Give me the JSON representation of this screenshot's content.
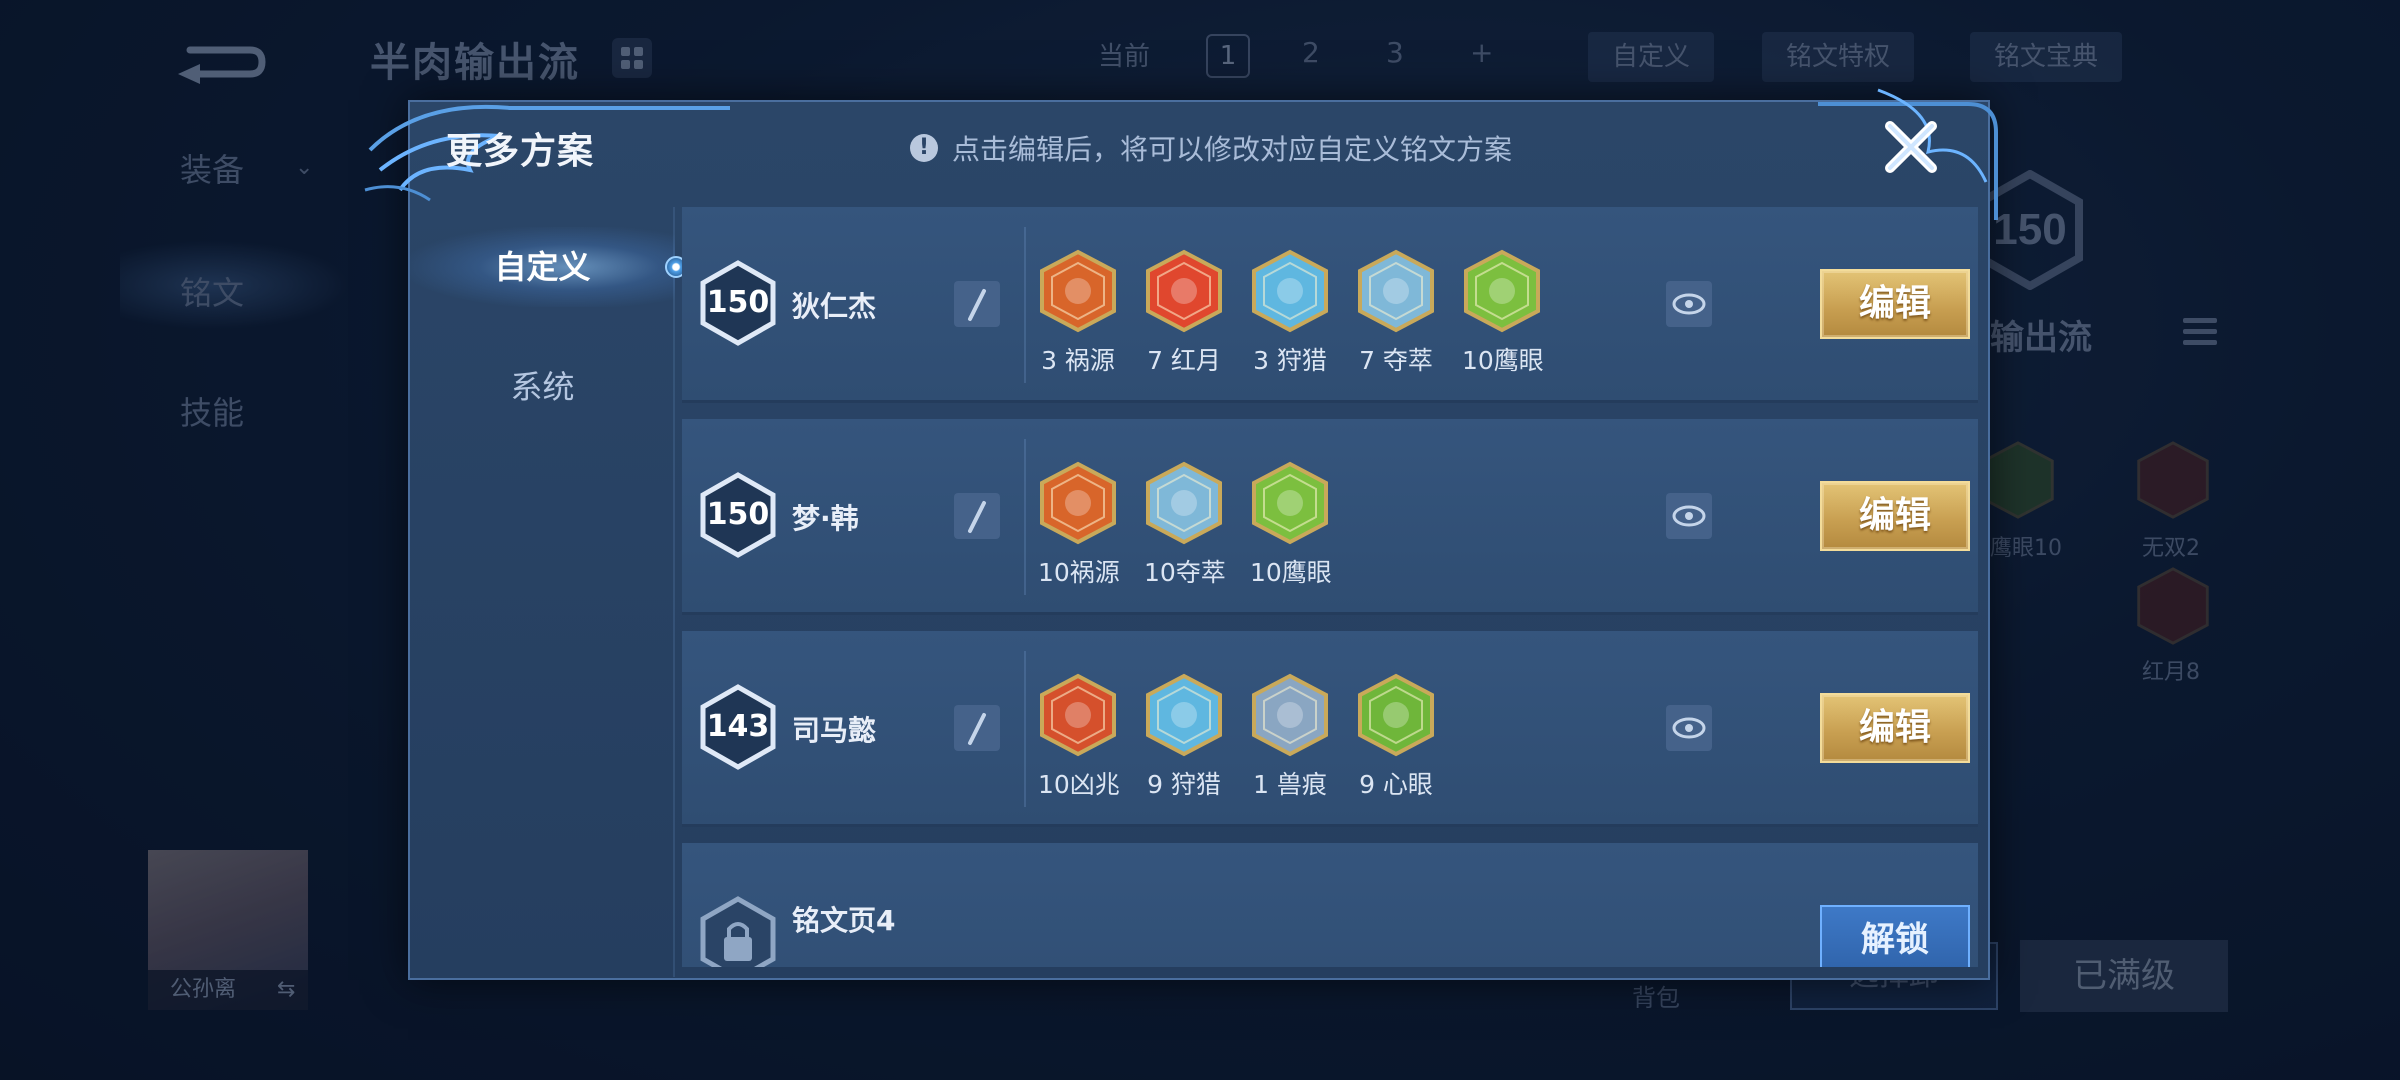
{
  "background": {
    "title": "半肉输出流",
    "side_nav": [
      "装备",
      "铭文",
      "技能"
    ],
    "page_label": "当前",
    "pages": [
      "1",
      "2",
      "3",
      "+"
    ],
    "custom_label": "自定义",
    "feature_btn": "铭文特权",
    "codex_btn": "铭文宝典",
    "right_level": "150",
    "right_title": "输出流",
    "runes": [
      {
        "label": "鹰眼10",
        "color": "green"
      },
      {
        "label": "无双2",
        "color": "red"
      },
      {
        "label": "红月8",
        "color": "red"
      }
    ],
    "hero_name": "公孙离",
    "bag_label": "背包",
    "select_btn": "选择卸",
    "max_btn": "已满级"
  },
  "modal": {
    "title": "更多方案",
    "hint": "点击编辑后，将可以修改对应自定义铭文方案",
    "tabs": [
      {
        "label": "自定义",
        "active": true
      },
      {
        "label": "系统",
        "active": false
      }
    ],
    "plans": [
      {
        "level": "150",
        "name": "狄仁杰",
        "edit_label": "编辑",
        "runes": [
          {
            "label": "3 祸源",
            "color": "#d8652a",
            "icon": "rune-huoyuan-icon"
          },
          {
            "label": "7 红月",
            "color": "#e0472e",
            "icon": "rune-hongyue-icon"
          },
          {
            "label": "3 狩猎",
            "color": "#5fb7e0",
            "icon": "rune-shoulie-icon"
          },
          {
            "label": "7 夺萃",
            "color": "#7fb8d8",
            "icon": "rune-duocui-icon"
          },
          {
            "label": "10鹰眼",
            "color": "#7cbf3f",
            "icon": "rune-yingyan-icon"
          }
        ]
      },
      {
        "level": "150",
        "name": "梦·韩",
        "edit_label": "编辑",
        "runes": [
          {
            "label": "10祸源",
            "color": "#d8652a",
            "icon": "rune-huoyuan-icon"
          },
          {
            "label": "10夺萃",
            "color": "#7fb8d8",
            "icon": "rune-duocui-icon"
          },
          {
            "label": "10鹰眼",
            "color": "#7cbf3f",
            "icon": "rune-yingyan-icon"
          }
        ]
      },
      {
        "level": "143",
        "name": "司马懿",
        "edit_label": "编辑",
        "runes": [
          {
            "label": "10凶兆",
            "color": "#d5502c",
            "icon": "rune-xiongzhao-icon"
          },
          {
            "label": "9 狩猎",
            "color": "#5fb7e0",
            "icon": "rune-shoulie-icon"
          },
          {
            "label": "1 兽痕",
            "color": "#8aa6c2",
            "icon": "rune-shouhen-icon"
          },
          {
            "label": "9 心眼",
            "color": "#6fb63a",
            "icon": "rune-xinyan-icon"
          }
        ]
      }
    ],
    "locked_plan": {
      "name": "铭文页4",
      "unlock_label": "解锁"
    }
  }
}
